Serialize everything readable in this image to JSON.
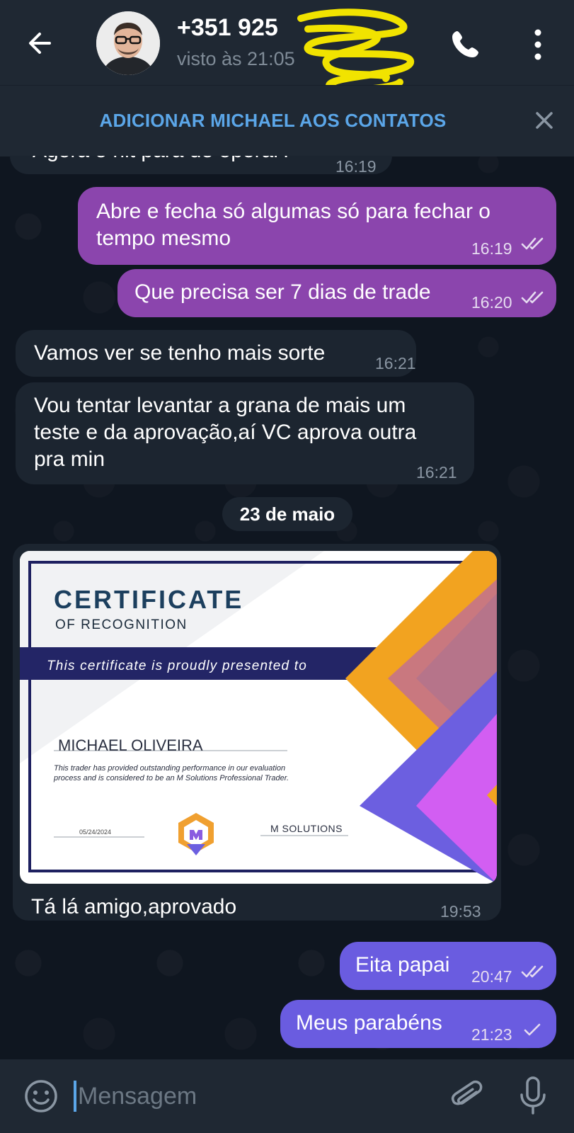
{
  "header": {
    "title": "+351 925",
    "status": "visto às 21:05",
    "back_icon": "arrow-left-icon",
    "call_icon": "phone-icon",
    "more_icon": "more-vertical-icon"
  },
  "add_contact_bar": {
    "label": "ADICIONAR MICHAEL AOS CONTATOS",
    "close_icon": "close-icon"
  },
  "messages": [
    {
      "direction": "in",
      "text": "Agora o nit para de operar?",
      "time": "16:19"
    },
    {
      "direction": "out",
      "line1": "Abre e fecha só algumas só para fechar o",
      "line2": "tempo mesmo",
      "time": "16:19"
    },
    {
      "direction": "out",
      "text": "Que precisa ser 7 dias de trade",
      "time": "16:20"
    },
    {
      "direction": "in",
      "text": "Vamos ver se tenho mais sorte",
      "time": "16:21"
    },
    {
      "direction": "in",
      "line1": "Vou tentar levantar a grana de mais um",
      "line2": "teste e da aprovação,aí VC aprova outra",
      "line3": "pra min",
      "time": "16:21"
    },
    {
      "direction": "in",
      "caption": "Tá lá amigo,aprovado",
      "time": "19:53"
    },
    {
      "direction": "out",
      "text": "Eita papai",
      "time": "20:47"
    },
    {
      "direction": "out",
      "text": "Meus parabéns",
      "time": "21:23"
    }
  ],
  "date_separator": "23 de maio",
  "certificate": {
    "title": "CERTIFICATE",
    "subtitle": "OF RECOGNITION",
    "presented": "This certificate is proudly presented to",
    "name": "MICHAEL OLIVEIRA",
    "description": "This trader has provided outstanding performance in our evaluation process and is considered to be an M Solutions Professional Trader.",
    "date": "05/24/2024",
    "company": "M SOLUTIONS"
  },
  "input": {
    "placeholder": "Mensagem",
    "emoji_icon": "emoji-icon",
    "attach_icon": "paperclip-icon",
    "mic_icon": "microphone-icon"
  },
  "colors": {
    "background": "#0e1621",
    "header": "#1f2833",
    "incoming_bubble": "#1c2530",
    "outgoing_purple": "#8b45ad",
    "outgoing_blue": "#6a5ce0",
    "accent": "#5ba6e8"
  }
}
